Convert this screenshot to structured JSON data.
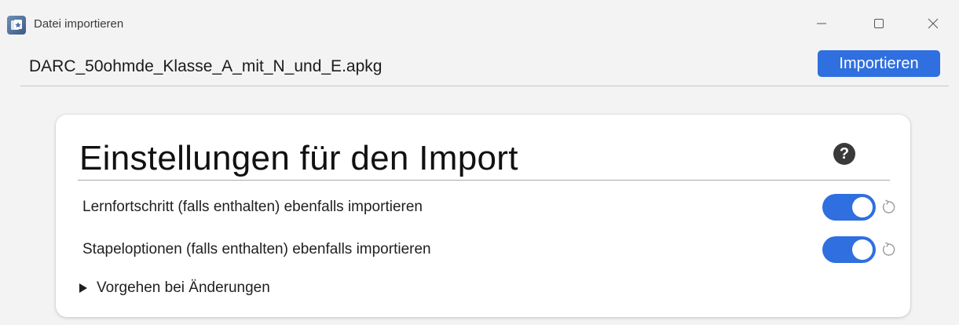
{
  "window": {
    "title": "Datei importieren",
    "controls": {
      "minimize_icon": "minimize-icon",
      "maximize_icon": "maximize-icon",
      "close_icon": "close-icon"
    }
  },
  "file": {
    "name": "DARC_50ohmde_Klasse_A_mit_N_und_E.apkg",
    "import_label": "Importieren"
  },
  "settings": {
    "title": "Einstellungen für den Import",
    "help_glyph": "?",
    "options": [
      {
        "label": "Lernfortschritt (falls enthalten) ebenfalls importieren",
        "enabled": true
      },
      {
        "label": "Stapeloptionen (falls enthalten) ebenfalls importieren",
        "enabled": true
      }
    ],
    "details_label": "Vorgehen bei Änderungen"
  },
  "colors": {
    "accent": "#2f6fe0",
    "background": "#f3f3f3",
    "card": "#ffffff"
  }
}
